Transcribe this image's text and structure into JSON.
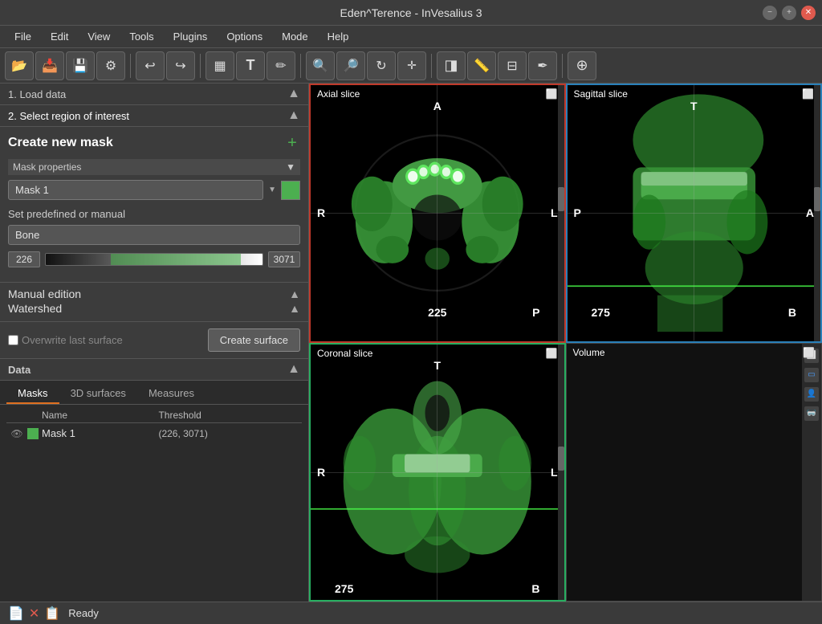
{
  "titlebar": {
    "title": "Eden^Terence - InVesalius 3",
    "minimize": "−",
    "maximize": "+",
    "close": "✕"
  },
  "menubar": {
    "items": [
      "File",
      "Edit",
      "View",
      "Tools",
      "Plugins",
      "Options",
      "Mode",
      "Help"
    ]
  },
  "toolbar": {
    "buttons": [
      {
        "name": "import-icon",
        "icon": "📂"
      },
      {
        "name": "import-dicom-icon",
        "icon": "📥"
      },
      {
        "name": "save-icon",
        "icon": "💾"
      },
      {
        "name": "settings-icon",
        "icon": "⚙"
      },
      {
        "name": "undo-icon",
        "icon": "↩"
      },
      {
        "name": "redo-icon",
        "icon": "↪"
      },
      {
        "name": "layout-icon",
        "icon": "▦"
      },
      {
        "name": "text-icon",
        "icon": "T"
      },
      {
        "name": "pencil-icon",
        "icon": "✏"
      },
      {
        "name": "zoom-in-icon",
        "icon": "🔍"
      },
      {
        "name": "zoom-out-icon",
        "icon": "🔎"
      },
      {
        "name": "rotate-icon",
        "icon": "↻"
      },
      {
        "name": "move-icon",
        "icon": "✛"
      },
      {
        "name": "contrast-icon",
        "icon": "◨"
      },
      {
        "name": "ruler-icon",
        "icon": "📏"
      },
      {
        "name": "slice-icon",
        "icon": "⊟"
      },
      {
        "name": "pencil2-icon",
        "icon": "✒"
      },
      {
        "name": "mask-icon",
        "icon": "⊕"
      }
    ]
  },
  "steps": {
    "step1": "1. Load data",
    "step2": "2. Select region of interest"
  },
  "create_mask": {
    "title": "Create new mask",
    "add_label": "+",
    "mask_properties_label": "Mask properties",
    "mask_name": "Mask 1",
    "predefined_label": "Set predefined or manual",
    "bone_option": "Bone",
    "threshold_min": "226",
    "threshold_max": "3071",
    "manual_edition_label": "Manual edition",
    "watershed_label": "Watershed"
  },
  "surface": {
    "overwrite_label": "Overwrite last surface",
    "create_button": "Create surface"
  },
  "data_section": {
    "title": "Data",
    "tabs": [
      "Masks",
      "3D surfaces",
      "Measures"
    ],
    "active_tab": "Masks",
    "table": {
      "headers": [
        "Name",
        "Threshold"
      ],
      "rows": [
        {
          "name": "Mask 1",
          "threshold": "(226, 3071)"
        }
      ]
    }
  },
  "slices": {
    "axial": {
      "label": "Axial slice",
      "orient_top": "A",
      "orient_bottom": "P",
      "orient_left": "R",
      "orient_right": "L",
      "bottom_num": "225",
      "bottom_right_num": "P"
    },
    "sagittal": {
      "label": "Sagittal slice",
      "orient_top": "T",
      "orient_bottom": "B",
      "orient_left": "P",
      "orient_right": "A",
      "bottom_num": "275",
      "bottom_right_num": "B"
    },
    "coronal": {
      "label": "Coronal slice",
      "orient_top": "T",
      "orient_bottom": "B",
      "orient_left": "R",
      "orient_right": "L",
      "bottom_num": "275",
      "bottom_right_num": "B"
    },
    "volume": {
      "label": "Volume"
    }
  },
  "statusbar": {
    "status": "Ready",
    "icons": [
      "📄",
      "✕",
      "📋"
    ]
  }
}
